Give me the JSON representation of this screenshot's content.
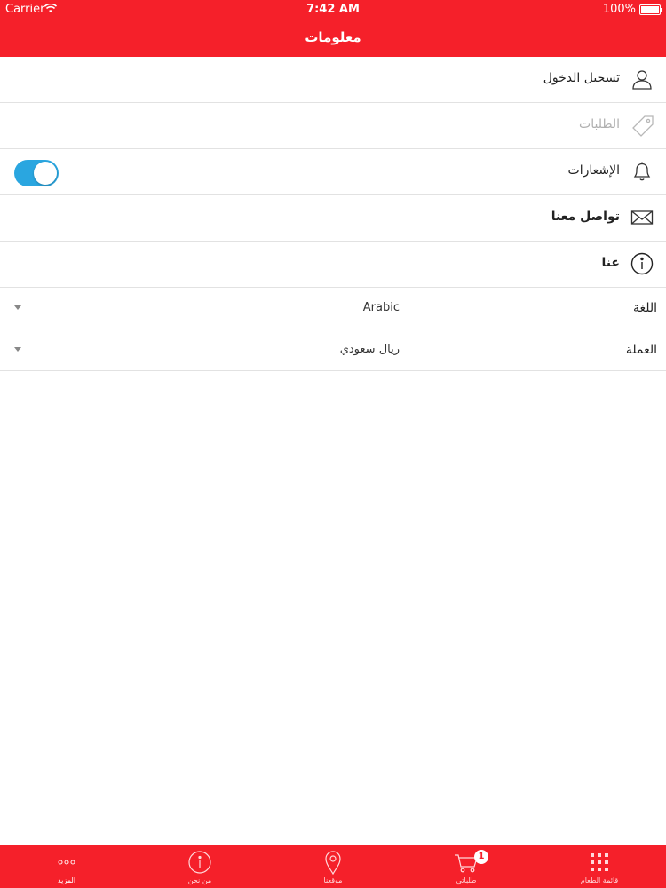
{
  "status_bar": {
    "carrier": "Carrier",
    "time": "7:42 AM",
    "battery": "100%"
  },
  "nav": {
    "title": "معلومات"
  },
  "menu": {
    "login": "تسجيل الدخول",
    "orders": "الطلبات",
    "notifications": "الإشعارات",
    "notifications_enabled": true,
    "contact": "تواصل معنا",
    "about": "عنا"
  },
  "settings": {
    "language_label": "اللغة",
    "language_value": "Arabic",
    "currency_label": "العملة",
    "currency_value": "ريال سعودي"
  },
  "tabs": {
    "menu": "قائمة الطعام",
    "orders": "طلباتي",
    "orders_badge": "1",
    "location": "موقعنا",
    "about": "من نحن",
    "more": "المزيد"
  },
  "colors": {
    "brand": "#f5202a",
    "toggle_on": "#2aa6e0"
  }
}
